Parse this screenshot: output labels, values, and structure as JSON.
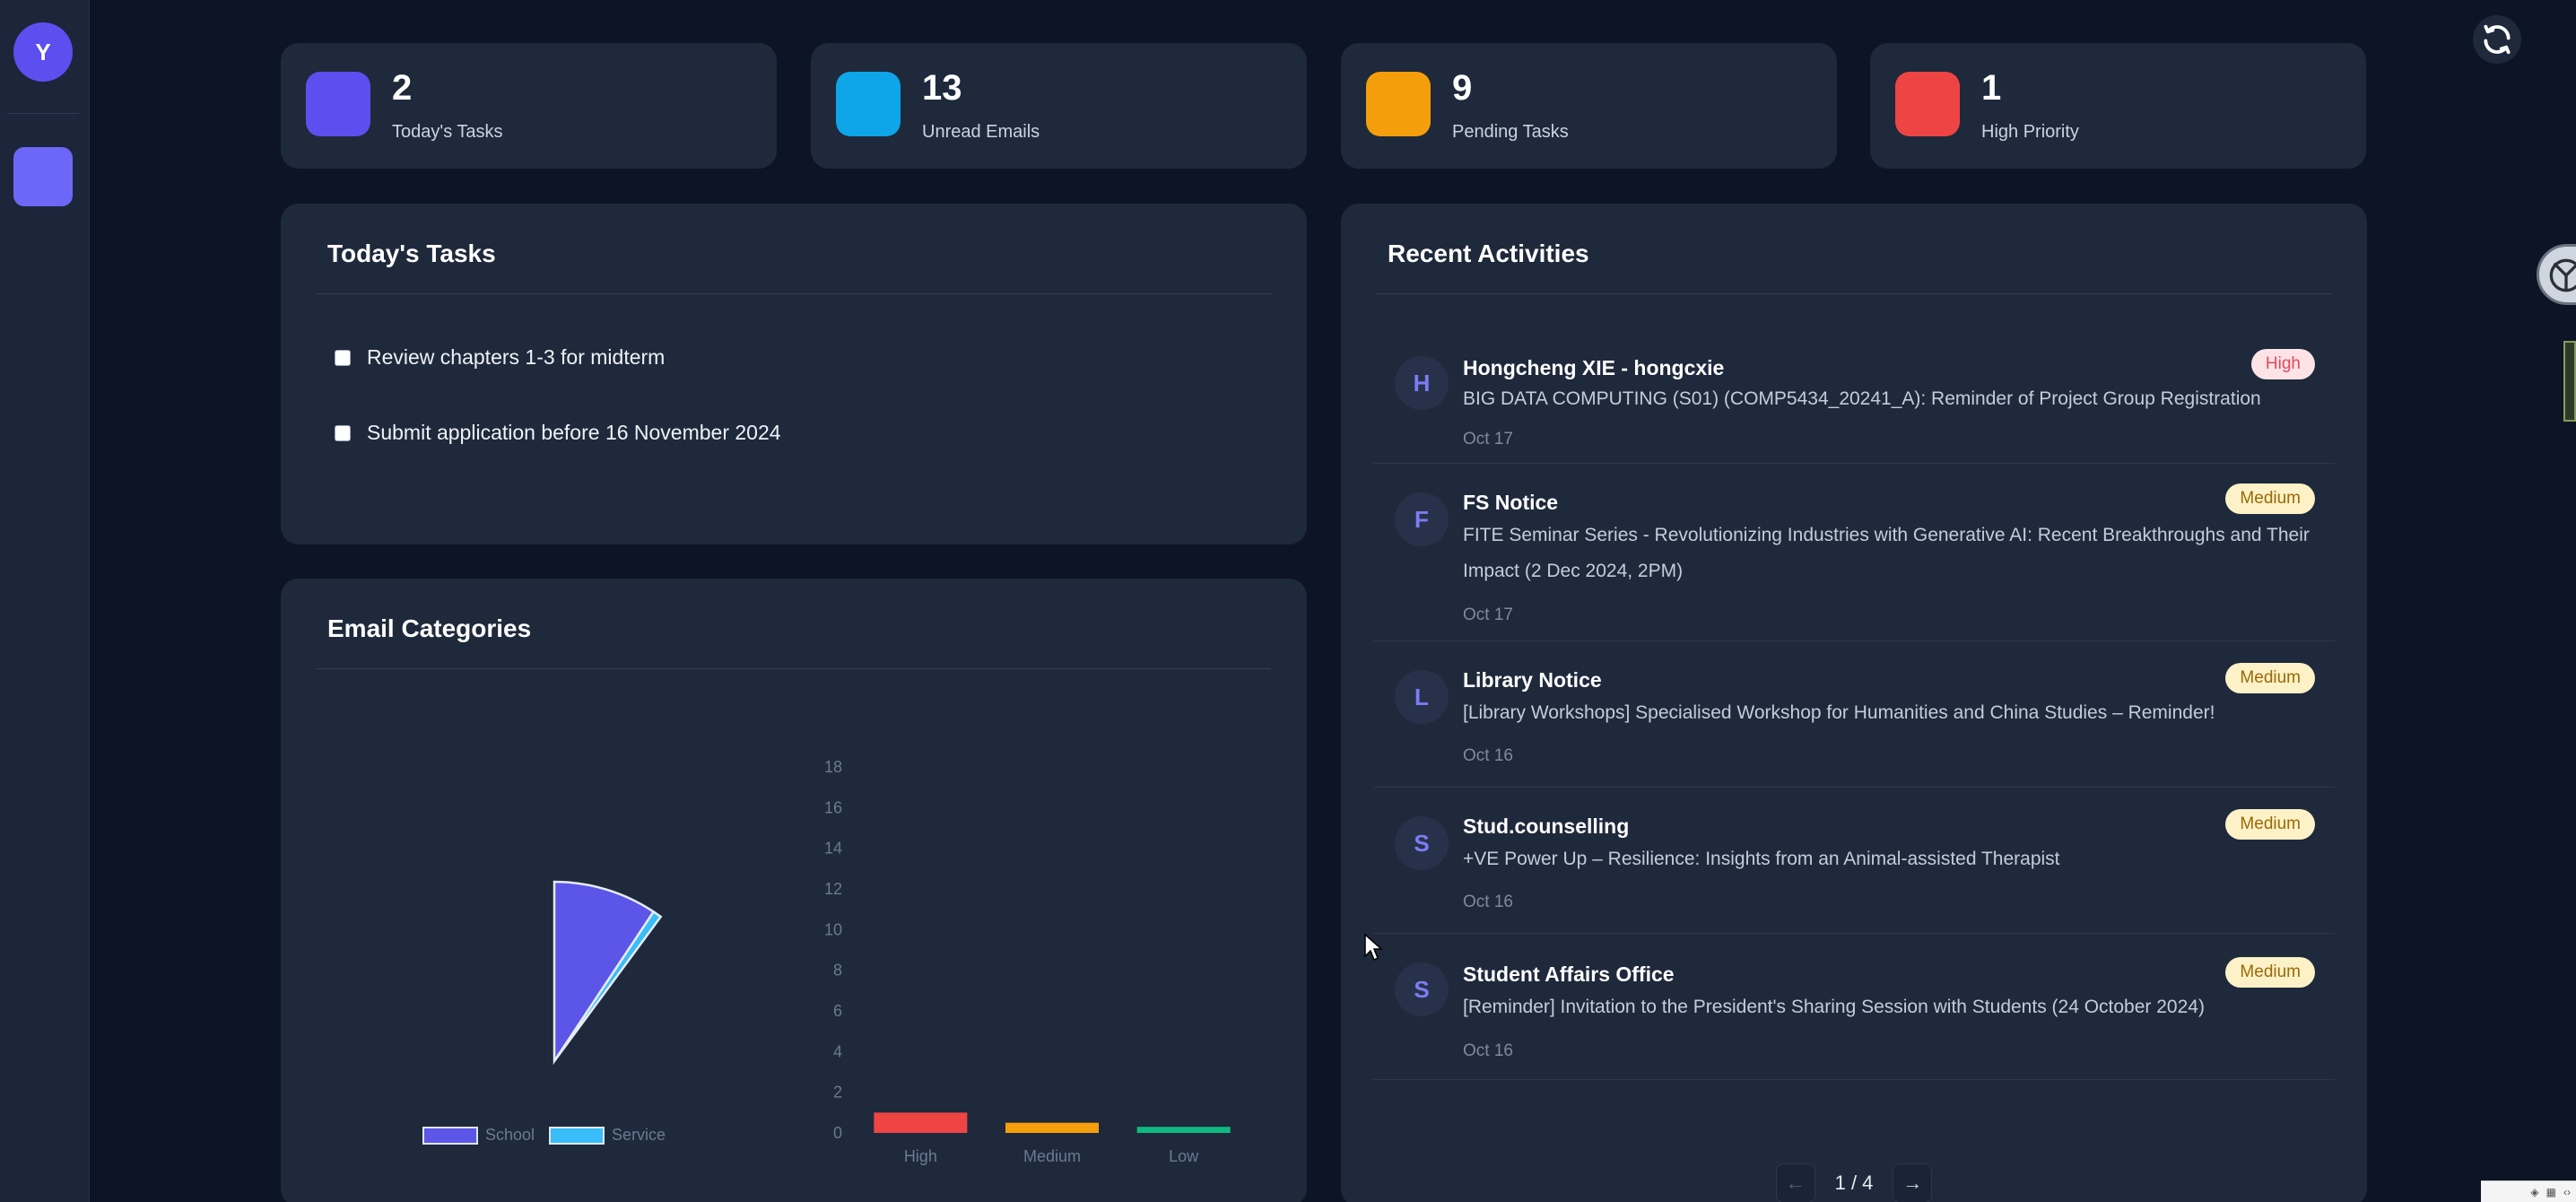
{
  "user": {
    "initial": "Y"
  },
  "stats": [
    {
      "value": "2",
      "label": "Today's Tasks",
      "color": "#5b4ff0",
      "icon": "tasks-icon"
    },
    {
      "value": "13",
      "label": "Unread Emails",
      "color": "#0ea5e9",
      "icon": "email-icon"
    },
    {
      "value": "9",
      "label": "Pending Tasks",
      "color": "#f59e0b",
      "icon": "pending-icon"
    },
    {
      "value": "1",
      "label": "High Priority",
      "color": "#ef4444",
      "icon": "priority-icon"
    }
  ],
  "tasks_card": {
    "title": "Today's Tasks",
    "items": [
      {
        "text": "Review chapters 1-3 for midterm"
      },
      {
        "text": "Submit application before 16 November 2024"
      }
    ]
  },
  "email_card": {
    "title": "Email Categories"
  },
  "chart_data": [
    {
      "type": "pie",
      "categories": [
        "School",
        "Service"
      ],
      "values": [
        12,
        1
      ],
      "colors": [
        "#5b55e8",
        "#38bdf8"
      ],
      "legend": [
        "School",
        "Service"
      ],
      "legend_placement": "bottom"
    },
    {
      "type": "bar",
      "categories": [
        "High",
        "Medium",
        "Low"
      ],
      "values": [
        1,
        0.5,
        0.3
      ],
      "colors": [
        "#ef4444",
        "#f59e0b",
        "#10b981"
      ],
      "ylim": [
        0,
        18
      ],
      "yticks": [
        0,
        2,
        4,
        6,
        8,
        10,
        12,
        14,
        16,
        18
      ],
      "grid": false
    }
  ],
  "activities_card": {
    "title": "Recent Activities",
    "items": [
      {
        "initial": "H",
        "sender": "Hongcheng XIE - hongcxie",
        "subject": "BIG DATA COMPUTING (S01) (COMP5434_20241_A): Reminder of Project Group Registration",
        "date": "Oct 17",
        "priority": "High"
      },
      {
        "initial": "F",
        "sender": "FS Notice",
        "subject": "FITE Seminar Series - Revolutionizing Industries with Generative AI: Recent Breakthroughs and Their Impact (2 Dec 2024, 2PM)",
        "date": "Oct 17",
        "priority": "Medium"
      },
      {
        "initial": "L",
        "sender": "Library Notice",
        "subject": "[Library Workshops] Specialised Workshop for Humanities and China Studies – Reminder!",
        "date": "Oct 16",
        "priority": "Medium"
      },
      {
        "initial": "S",
        "sender": "Stud.counselling",
        "subject": "+VE Power Up – Resilience: Insights from an Animal-assisted Therapist",
        "date": "Oct 16",
        "priority": "Medium"
      },
      {
        "initial": "S",
        "sender": "Student Affairs Office",
        "subject": "[Reminder] Invitation to the President's Sharing Session with Students (24 October 2024)",
        "date": "Oct 16",
        "priority": "Medium"
      }
    ],
    "pagination": {
      "prev": "←",
      "info": "1 / 4",
      "next": "→"
    }
  }
}
